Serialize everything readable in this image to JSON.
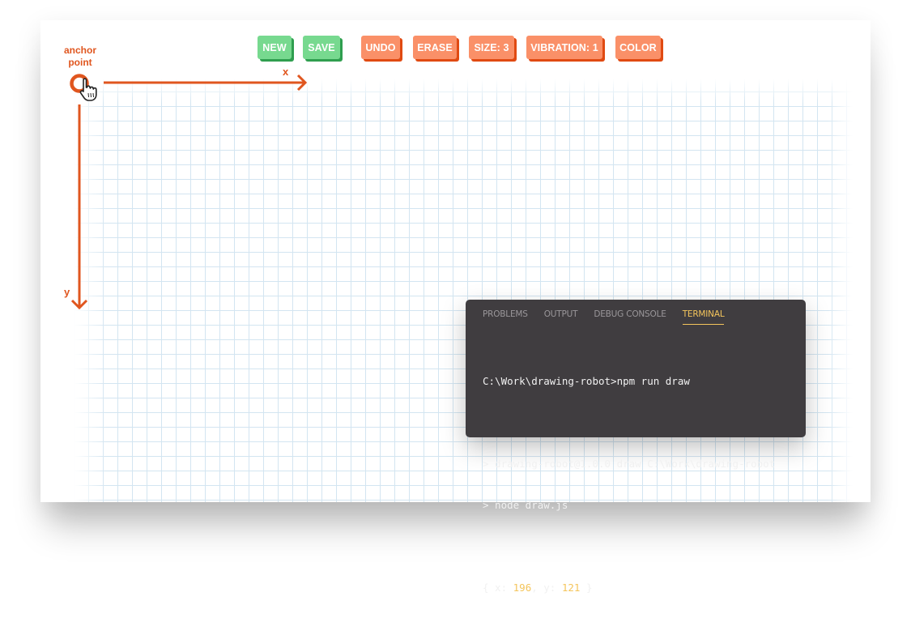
{
  "toolbar": {
    "buttons": [
      {
        "label": "NEW",
        "style": "green"
      },
      {
        "label": "SAVE",
        "style": "green"
      },
      {
        "label": "UNDO",
        "style": "orange"
      },
      {
        "label": "ERASE",
        "style": "orange"
      },
      {
        "label": "SIZE: 3",
        "style": "orange"
      },
      {
        "label": "VIBRATION: 1",
        "style": "orange"
      },
      {
        "label": "COLOR",
        "style": "orange"
      }
    ]
  },
  "canvas": {
    "anchor_label_line1": "anchor",
    "anchor_label_line2": "point",
    "x_axis_label": "x",
    "y_axis_label": "y",
    "accent_color": "#e0561f",
    "grid_color": "#d3e5f1"
  },
  "terminal": {
    "tabs": [
      {
        "label": "PROBLEMS",
        "active": false
      },
      {
        "label": "OUTPUT",
        "active": false
      },
      {
        "label": "DEBUG CONSOLE",
        "active": false
      },
      {
        "label": "TERMINAL",
        "active": true
      }
    ],
    "lines": {
      "command": "C:\\Work\\drawing-robot>npm run draw",
      "script_line1": "> drawing-robot@1.0.0 draw C:\\Work\\drawing-robot",
      "script_line2": "> node draw.js",
      "result_open": "{ x: ",
      "result_x": "196",
      "result_sep": ", y: ",
      "result_y": "121",
      "result_close": " }"
    }
  }
}
